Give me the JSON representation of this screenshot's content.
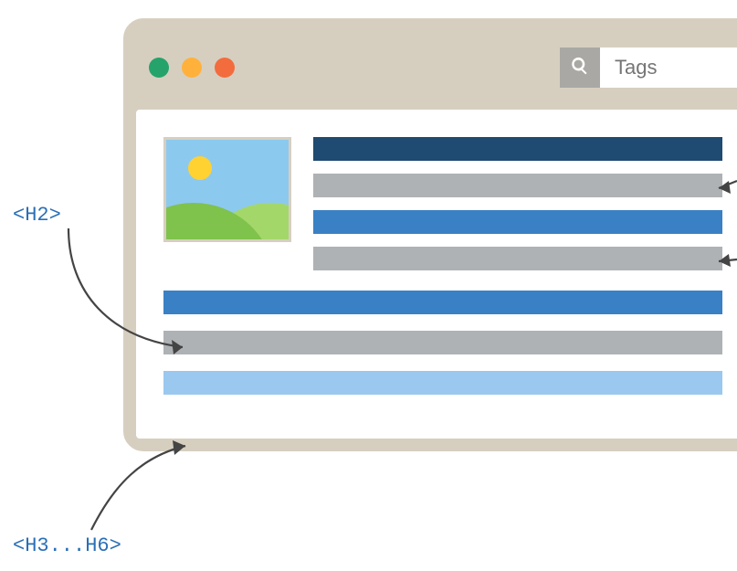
{
  "browser": {
    "search": {
      "placeholder": "Tags",
      "value": ""
    },
    "traffic_lights": [
      "green",
      "yellow",
      "red"
    ],
    "icons": {
      "search": "magnifying-glass"
    }
  },
  "labels": {
    "h2": "<H2>",
    "h3_h6": "<H3...H6>"
  },
  "content": {
    "thumbnail": "landscape-image",
    "top_bars": [
      {
        "kind": "h1",
        "color": "#1f4a71"
      },
      {
        "kind": "text",
        "color": "#aeb2b5"
      },
      {
        "kind": "h2",
        "color": "#3a80c4"
      },
      {
        "kind": "text",
        "color": "#aeb2b5"
      }
    ],
    "full_bars": [
      {
        "kind": "h2",
        "color": "#3a80c4"
      },
      {
        "kind": "text",
        "color": "#aeb2b5"
      },
      {
        "kind": "h3",
        "color": "#9bc8ef"
      }
    ]
  }
}
